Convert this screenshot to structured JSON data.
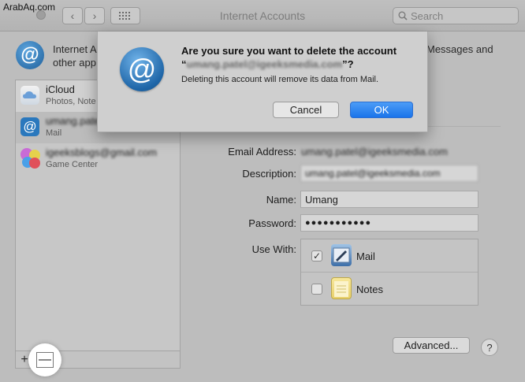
{
  "watermark": "ArabAq.com",
  "window": {
    "title": "Internet Accounts",
    "search": {
      "placeholder": "Search"
    }
  },
  "header": {
    "line1": "Internet A",
    "line2": "other app",
    "right_line1": "Messages and"
  },
  "sidebar": {
    "accounts": [
      {
        "name": "iCloud",
        "subtitle": "Photos, Note"
      },
      {
        "name": "umang.patel",
        "subtitle": "Mail"
      },
      {
        "name": "igeeksblogs@gmail.com",
        "subtitle": "Game Center"
      }
    ],
    "add_label": "+",
    "remove_label": "—"
  },
  "details": {
    "email_label": "Email Address:",
    "email_value": "umang.patel@igeeksmedia.com",
    "description_label": "Description:",
    "description_value": "umang.patel@igeeksmedia.com",
    "name_label": "Name:",
    "name_value": "Umang",
    "password_label": "Password:",
    "password_value": "●●●●●●●●●●●",
    "usewith_label": "Use With:",
    "apps": [
      {
        "label": "Mail",
        "checked": true,
        "check_mark": "✓"
      },
      {
        "label": "Notes",
        "checked": false,
        "check_mark": ""
      }
    ],
    "advanced_label": "Advanced...",
    "help_label": "?"
  },
  "dialog": {
    "title_prefix": "Are you sure you want to delete the account",
    "title_open_quote": "“",
    "title_email": "umang.patel@igeeksmedia.com",
    "title_suffix": "”?",
    "message": "Deleting this account will remove its data from Mail.",
    "cancel_label": "Cancel",
    "ok_label": "OK",
    "icon_glyph": "@"
  },
  "colors": {
    "ok_button": "#1a74ea",
    "account_icon": "#2a78bd"
  }
}
